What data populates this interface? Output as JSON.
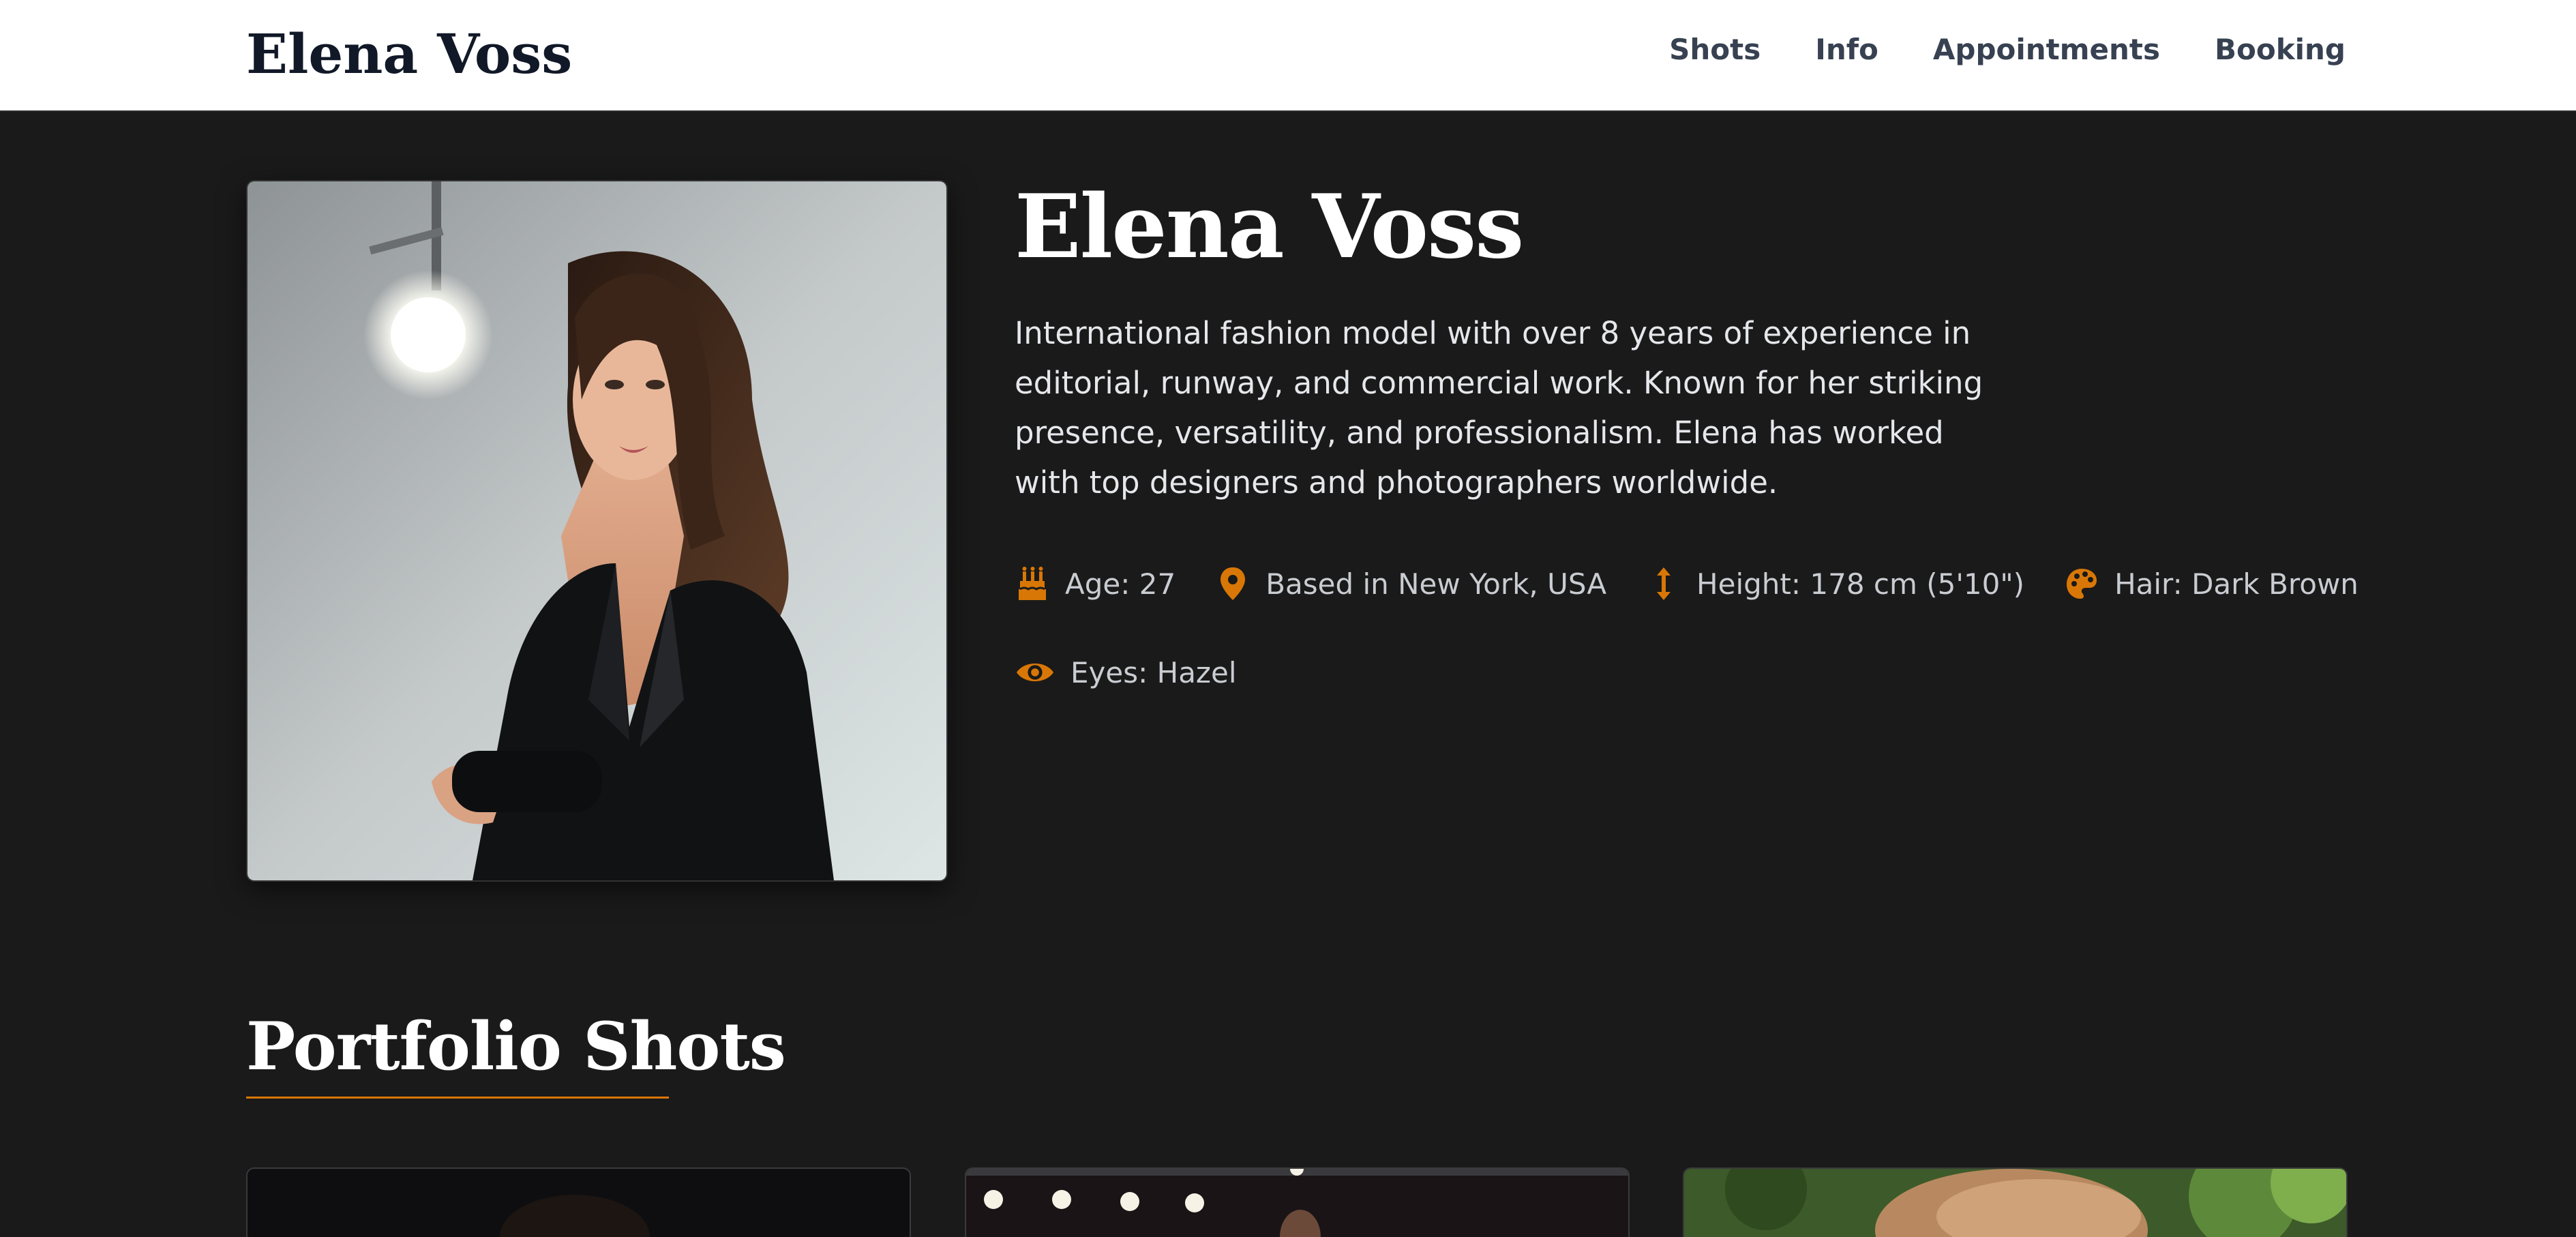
{
  "header": {
    "brand": "Elena Voss",
    "nav": [
      "Shots",
      "Info",
      "Appointments",
      "Booking"
    ]
  },
  "profile": {
    "name": "Elena Voss",
    "bio": "International fashion model with over 8 years of experience in editorial, runway, and commercial work. Known for her striking presence, versatility, and professionalism. Elena has worked with top designers and photographers worldwide.",
    "attributes": [
      {
        "icon": "birthday-cake-icon",
        "label": "Age: 27"
      },
      {
        "icon": "location-pin-icon",
        "label": "Based in New York, USA"
      },
      {
        "icon": "height-arrows-icon",
        "label": "Height: 178 cm (5'10\")"
      },
      {
        "icon": "palette-icon",
        "label": "Hair: Dark Brown"
      },
      {
        "icon": "eye-icon",
        "label": "Eyes: Hazel"
      }
    ]
  },
  "portfolio": {
    "title": "Portfolio Shots"
  },
  "colors": {
    "accent": "#d97706",
    "background": "#1a1a1a",
    "header_bg": "#ffffff",
    "nav_text": "#374151"
  }
}
